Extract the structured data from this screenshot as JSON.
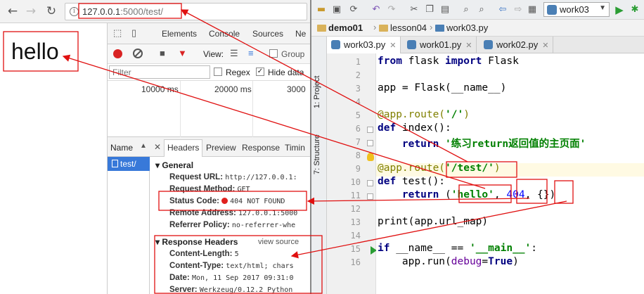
{
  "browser": {
    "url_host": "127.0.0.1",
    "url_rest": ":5000/test/",
    "page_text": "hello"
  },
  "devtools": {
    "tabs": [
      "Elements",
      "Console",
      "Sources",
      "Ne"
    ],
    "view_label": "View:",
    "group_label": "Group",
    "filter_placeholder": "Filter",
    "regex_label": "Regex",
    "hide_data_label": "Hide data",
    "timeline_marks": [
      "10000 ms",
      "20000 ms",
      "3000"
    ],
    "list_header": "Name",
    "request_name": "test/",
    "detail_tabs": [
      "Headers",
      "Preview",
      "Response",
      "Timin"
    ],
    "general_label": "General",
    "general": [
      {
        "key": "Request URL:",
        "value": "http://127.0.0.1:"
      },
      {
        "key": "Request Method:",
        "value": "GET"
      },
      {
        "key": "Status Code:",
        "value": "404 NOT FOUND"
      },
      {
        "key": "Remote Address:",
        "value": "127.0.0.1:5000"
      },
      {
        "key": "Referrer Policy:",
        "value": "no-referrer-whe"
      }
    ],
    "response_headers_label": "Response Headers",
    "view_source": "view source",
    "response_headers": [
      {
        "key": "Content-Length:",
        "value": "5"
      },
      {
        "key": "Content-Type:",
        "value": "text/html; chars"
      },
      {
        "key": "Date:",
        "value": "Mon, 11 Sep 2017 09:31:0"
      },
      {
        "key": "Server:",
        "value": "Werkzeug/0.12.2 Python"
      }
    ]
  },
  "ide": {
    "run_config": "work03",
    "breadcrumbs": [
      "demo01",
      "lesson04",
      "work03.py"
    ],
    "side_labels": [
      "1: Project",
      "7: Structure"
    ],
    "file_tabs": [
      "work03.py",
      "work01.py",
      "work02.py"
    ],
    "line_numbers": [
      "1",
      "2",
      "3",
      "4",
      "5",
      "6",
      "7",
      "8",
      "9",
      "10",
      "11",
      "12",
      "13",
      "14",
      "15",
      "16"
    ],
    "code": {
      "l1_from": "from",
      "l1_mod": " flask ",
      "l1_import": "import",
      "l1_name": " Flask",
      "l3": "app = Flask(__name__)",
      "l5_deco": "@app.route(",
      "l5_str": "'/'",
      "l5_end": ")",
      "l6_def": "def",
      "l6_rest": " index():",
      "l7_return": "    return",
      "l7_str": " '练习return返回值的主页面'",
      "l9_deco": "@app.route(",
      "l9_str": "'/test/'",
      "l9_end": ")",
      "l10_def": "def",
      "l10_rest": " test():",
      "l11_return": "    return",
      "l11_open": " (",
      "l11_str": "'hello'",
      "l11_comma": ", ",
      "l11_num": "404",
      "l11_tail": ", {})",
      "l13": "print(app.url_map)",
      "l15_if": "if",
      "l15_mid": " __name__ == ",
      "l15_str": "'__main__'",
      "l15_end": ":",
      "l16_pre": "    app.run(",
      "l16_kw": "debug",
      "l16_eq": "=",
      "l16_true": "True",
      "l16_end": ")"
    }
  },
  "colors": {
    "annotation": "#e01010",
    "selected_row": "#3879d9",
    "highlight_line": "#fffae3"
  }
}
